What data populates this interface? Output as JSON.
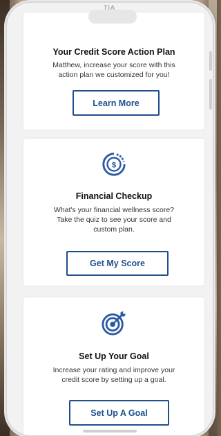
{
  "header": {
    "logo_partial": "TIA"
  },
  "cards": [
    {
      "title": "Your Credit Score Action Plan",
      "body_lines": [
        "Matthew, increase your score with this",
        "action plan we customized for you!"
      ],
      "button_label": "Learn More"
    },
    {
      "icon": "dollar-progress-icon",
      "title": "Financial Checkup",
      "body_lines": [
        "What's your financial wellness score?",
        "Take the quiz to see your score and",
        "custom plan."
      ],
      "button_label": "Get My Score"
    },
    {
      "icon": "target-arrow-icon",
      "title": "Set Up Your Goal",
      "body_lines": [
        "Increase your rating and improve your",
        "credit score by setting up a goal."
      ],
      "button_label": "Set Up A Goal"
    }
  ],
  "colors": {
    "accent": "#1f4e8c",
    "card_bg": "#ffffff",
    "screen_bg": "#f2f2f2"
  }
}
